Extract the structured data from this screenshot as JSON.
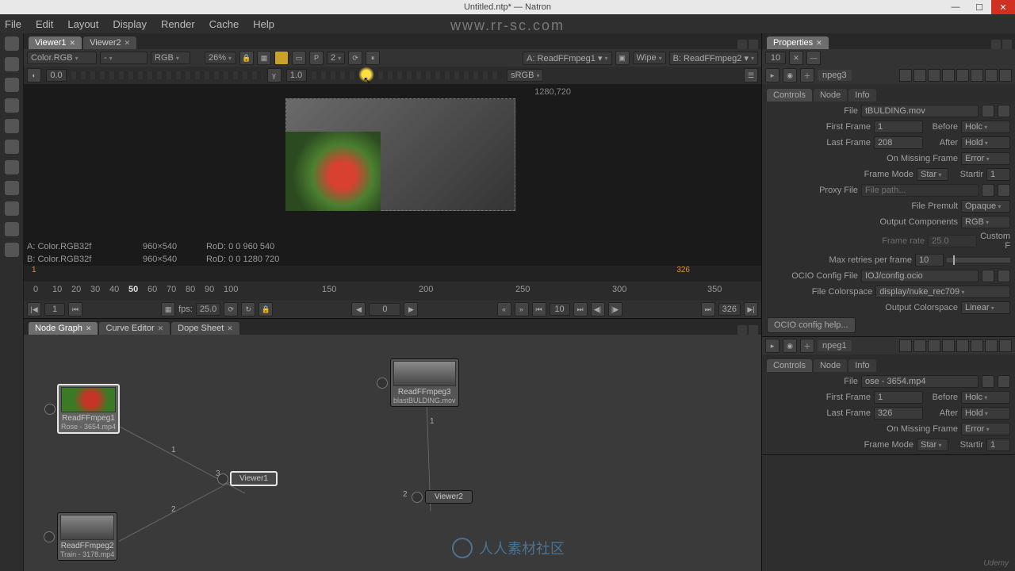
{
  "window": {
    "title": "Untitled.ntp* — Natron",
    "url_watermark": "www.rr-sc.com",
    "min": "—",
    "max": "☐",
    "close": "✕"
  },
  "menu": [
    "File",
    "Edit",
    "Layout",
    "Display",
    "Render",
    "Cache",
    "Help"
  ],
  "viewer": {
    "tabs": [
      "Viewer1",
      "Viewer2"
    ],
    "layer": "Color.RGB",
    "alpha": "-",
    "channels": "RGB",
    "zoom": "26%",
    "downscale": "2",
    "a_input": "A: ReadFFmpeg1 ▾",
    "op": "Wipe",
    "b_input": "B: ReadFFmpeg2 ▾",
    "gain": "0.0",
    "gamma": "1.0",
    "lut": "sRGB",
    "dim": "1280,720",
    "meta_a": "A: Color.RGB32f",
    "meta_b": "B: Color.RGB32f",
    "res_a": "960×540",
    "res_b": "960×540",
    "rod_a": "RoD: 0 0 960 540",
    "rod_b": "RoD: 0 0 1280 720",
    "tl_start": "1",
    "tl_end": "326",
    "ruler": [
      "0",
      "10",
      "20",
      "30",
      "40",
      "50",
      "60",
      "70",
      "80",
      "90",
      "100",
      "150",
      "200",
      "250",
      "300",
      "350"
    ],
    "frame_left": "1",
    "fps": "25.0",
    "fps_label": "fps:",
    "frame_mid": "0",
    "frame_skip": "10",
    "frame_right": "326"
  },
  "graph": {
    "tabs": [
      "Node Graph",
      "Curve Editor",
      "Dope Sheet"
    ],
    "nodes": {
      "r1": {
        "name": "ReadFFmpeg1",
        "sub": "Rose - 3654.mp4"
      },
      "r2": {
        "name": "ReadFFmpeg2",
        "sub": "Train - 3178.mp4"
      },
      "r3": {
        "name": "ReadFFmpeg3",
        "sub": "blastBULDING.mov"
      },
      "v1": {
        "name": "Viewer1"
      },
      "v2": {
        "name": "Viewer2"
      }
    },
    "labels": {
      "l1": "1",
      "l2": "2",
      "l3": "3",
      "l5": "1",
      "l6": "2"
    }
  },
  "props": {
    "title": "Properties",
    "max_panels": "10",
    "panel1": {
      "node": "npeg3",
      "tabs": [
        "Controls",
        "Node",
        "Info"
      ],
      "file_lbl": "File",
      "file": "tBULDING.mov",
      "first_frame_lbl": "First Frame",
      "first_frame": "1",
      "before_lbl": "Before",
      "before": "Holc",
      "last_frame_lbl": "Last Frame",
      "last_frame": "208",
      "after_lbl": "After",
      "after": "Hold",
      "on_missing_lbl": "On Missing Frame",
      "on_missing": "Error",
      "frame_mode_lbl": "Frame Mode",
      "frame_mode": "Star",
      "startir_lbl": "Startir",
      "startir": "1",
      "proxy_lbl": "Proxy File",
      "proxy": "File path...",
      "premult_lbl": "File Premult",
      "premult": "Opaque",
      "outcomp_lbl": "Output Components",
      "outcomp": "RGB",
      "framerate_lbl": "Frame rate",
      "framerate": "25.0",
      "custom_lbl": "Custom F",
      "retries_lbl": "Max retries per frame",
      "retries": "10",
      "ocio_cfg_lbl": "OCIO Config File",
      "ocio_cfg": "IOJ/config.ocio",
      "colorspace_lbl": "File Colorspace",
      "colorspace": "display/nuke_rec709",
      "outcs_lbl": "Output Colorspace",
      "outcs": "Linear",
      "help": "OCIO config help..."
    },
    "panel2": {
      "node": "npeg1",
      "tabs": [
        "Controls",
        "Node",
        "Info"
      ],
      "file_lbl": "File",
      "file": "ose - 3654.mp4",
      "first_frame_lbl": "First Frame",
      "first_frame": "1",
      "before_lbl": "Before",
      "before": "Holc",
      "last_frame_lbl": "Last Frame",
      "last_frame": "326",
      "after_lbl": "After",
      "after": "Hold",
      "on_missing_lbl": "On Missing Frame",
      "on_missing": "Error",
      "frame_mode_lbl": "Frame Mode",
      "frame_mode": "Star",
      "startir_lbl": "Startir",
      "startir": "1"
    }
  },
  "brand": {
    "logo": "人人素材社区",
    "udemy": "Udemy"
  }
}
